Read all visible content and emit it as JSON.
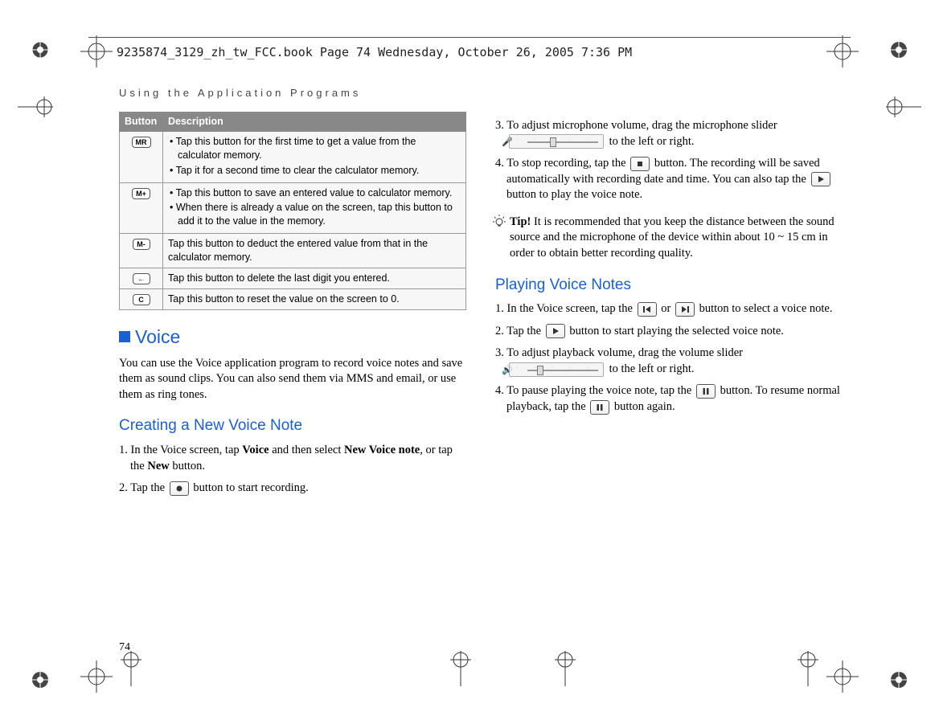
{
  "header": {
    "imprint": "9235874_3129_zh_tw_FCC.book  Page 74  Wednesday, October 26, 2005  7:36 PM"
  },
  "running_head": "Using the Application Programs",
  "page_number": "74",
  "calc_table": {
    "headers": {
      "button": "Button",
      "description": "Description"
    },
    "rows": [
      {
        "btn": "MR",
        "bullets": [
          "Tap this button for the first time to get a value from the calculator memory.",
          "Tap it for a second time to clear the calculator memory."
        ]
      },
      {
        "btn": "M+",
        "bullets": [
          "Tap this button to save an entered value to calculator memory.",
          "When there is already a value on the screen, tap this button to add it to the value in the memory."
        ]
      },
      {
        "btn": "M-",
        "desc": "Tap this button to deduct the entered value from that in the calculator memory."
      },
      {
        "btn": "←",
        "desc": "Tap this button to delete the last digit you entered."
      },
      {
        "btn": "C",
        "desc": "Tap this button to reset the value on the screen to 0."
      }
    ]
  },
  "voice": {
    "title": "Voice",
    "intro": "You can use the Voice application program to record voice notes and save them as sound clips. You can also send them via MMS and email, or use them as ring tones.",
    "create": {
      "title": "Creating a New Voice Note",
      "step1_a": "1. In the Voice screen, tap ",
      "step1_b": "Voice",
      "step1_c": " and then select ",
      "step1_d": "New Voice note",
      "step1_e": ", or tap the ",
      "step1_f": "New",
      "step1_g": " button.",
      "step2_a": "2. Tap the ",
      "step2_b": " button to start recording.",
      "step3_a": "3. To adjust microphone volume, drag the microphone slider ",
      "step3_b": " to the left or right.",
      "step4_a": "4. To stop recording, tap the ",
      "step4_b": " button. The recording will be saved automatically with recording date and time. You can also tap the ",
      "step4_c": " button to play the voice note."
    },
    "tip": {
      "label": "Tip!",
      "text": " It is recommended that you keep the distance between the sound source and the microphone of the device within about 10 ~ 15 cm in order to obtain better recording quality."
    },
    "play": {
      "title": "Playing Voice Notes",
      "step1_a": "1. In the Voice screen, tap the ",
      "step1_b": " or ",
      "step1_c": " button to select a voice note.",
      "step2_a": "2. Tap the ",
      "step2_b": " button to start playing the selected voice note.",
      "step3_a": "3. To adjust playback volume, drag the volume slider ",
      "step3_b": " to the left or right.",
      "step4_a": "4. To pause playing the voice note, tap the ",
      "step4_b": " button. To resume normal playback, tap the ",
      "step4_c": " button again."
    }
  }
}
